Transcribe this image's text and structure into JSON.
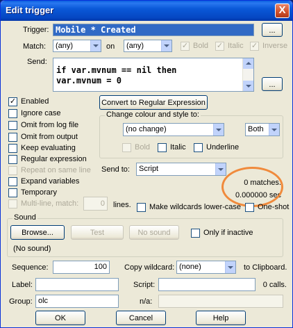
{
  "window": {
    "title": "Edit trigger",
    "close_glyph": "X"
  },
  "trigger": {
    "label": "Trigger:",
    "value": "Mobile * Created",
    "browse": "..."
  },
  "match": {
    "label": "Match:",
    "color1": "(any)",
    "on_label": "on",
    "color2": "(any)",
    "bold": "Bold",
    "italic": "Italic",
    "inverse": "Inverse"
  },
  "send": {
    "label": "Send:",
    "line1": "if var.mvnum == nil then",
    "line2": "var.mvnum = 0",
    "browse": "..."
  },
  "options": {
    "enabled": "Enabled",
    "ignore_case": "Ignore case",
    "omit_log": "Omit from log file",
    "omit_output": "Omit from output",
    "keep_evaluating": "Keep evaluating",
    "regular_expression": "Regular expression",
    "repeat_same_line": "Repeat on same line",
    "expand_variables": "Expand variables",
    "temporary": "Temporary",
    "multiline": "Multi-line, match:",
    "multiline_lines": "0",
    "lines_label": "lines."
  },
  "convert_button": "Convert to Regular Expression",
  "colour": {
    "legend": "Change colour and style to:",
    "value": "(no change)",
    "both": "Both",
    "bold": "Bold",
    "italic": "Italic",
    "underline": "Underline"
  },
  "send_to": {
    "label": "Send to:",
    "value": "Script"
  },
  "stats": {
    "matches": "0 matches.",
    "time": "0.000000 sec"
  },
  "wildcards_lower": "Make wildcards lower-case",
  "one_shot": "One-shot",
  "sound": {
    "legend": "Sound",
    "browse": "Browse...",
    "test": "Test",
    "no_sound": "No sound",
    "only_inactive": "Only if inactive",
    "current": "(No sound)"
  },
  "sequence": {
    "label": "Sequence:",
    "value": "100"
  },
  "copy_wildcard": {
    "label": "Copy wildcard:",
    "value": "(none)",
    "suffix": "to Clipboard."
  },
  "label": {
    "label": "Label:",
    "value": ""
  },
  "script": {
    "label": "Script:",
    "value": "",
    "calls": "0 calls."
  },
  "group": {
    "label": "Group:",
    "value": "olc"
  },
  "na": {
    "label": "n/a:",
    "value": ""
  },
  "buttons": {
    "ok": "OK",
    "cancel": "Cancel",
    "help": "Help"
  }
}
